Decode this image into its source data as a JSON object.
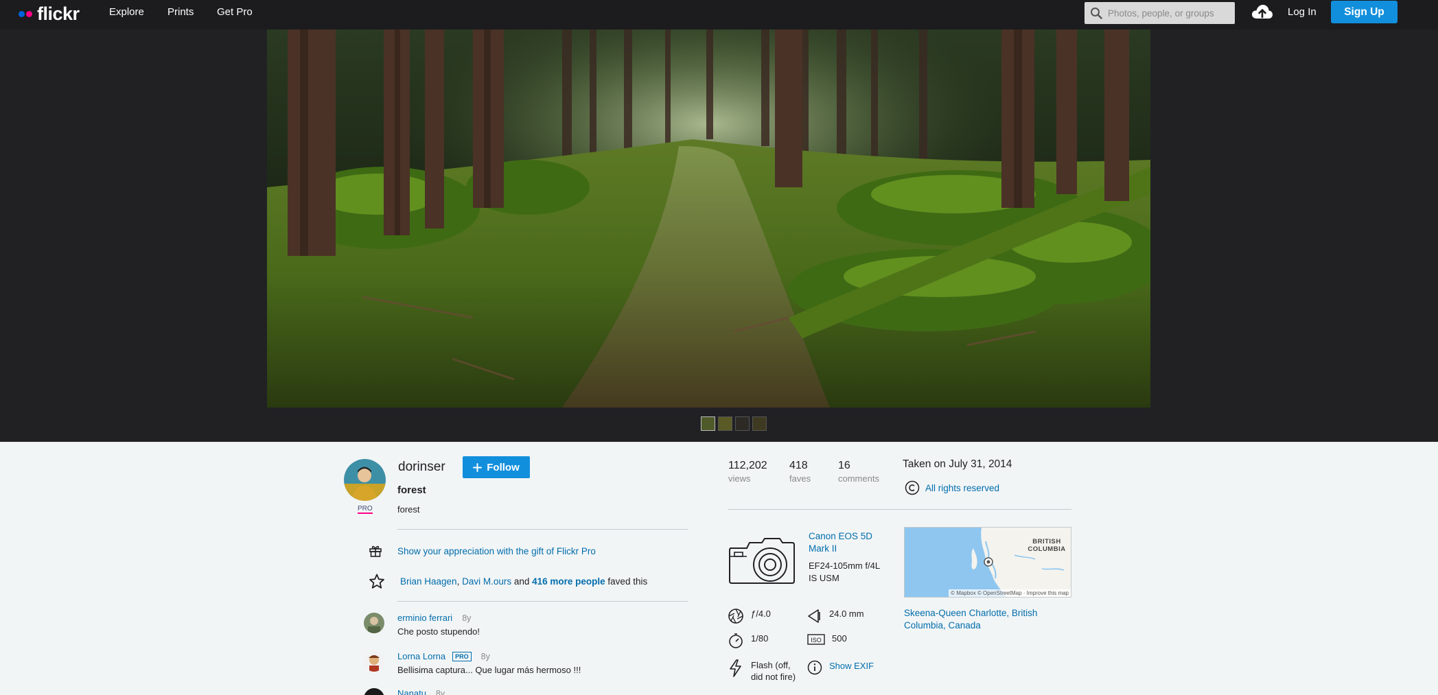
{
  "nav": {
    "logo": "flickr",
    "links": [
      "Explore",
      "Prints",
      "Get Pro"
    ],
    "search_placeholder": "Photos, people, or groups",
    "login": "Log In",
    "signup": "Sign Up"
  },
  "photo": {
    "alt": "forest",
    "thumbs_count": 4
  },
  "owner": {
    "name": "dorinser",
    "badge": "PRO",
    "follow_label": "Follow"
  },
  "title": "forest",
  "description": "forest",
  "gift": {
    "text": "Show your appreciation with the gift of Flickr Pro"
  },
  "faves_line": {
    "user1": "Brian Haagen",
    "sep": ", ",
    "user2": "Davi M.ours",
    "and": " and ",
    "more": "416 more people",
    "suffix": " faved this"
  },
  "comments": [
    {
      "author": "erminio ferrari",
      "badge": "",
      "age": "8y",
      "text": "Che posto stupendo!"
    },
    {
      "author": "Lorna Lorna",
      "badge": "PRO",
      "age": "8y",
      "text": "Bellisima captura... Que lugar más hermoso !!!"
    },
    {
      "author": "Nanatu",
      "badge": "",
      "age": "8y",
      "text": ""
    }
  ],
  "stats": {
    "views": "112,202",
    "views_label": "views",
    "faves": "418",
    "faves_label": "faves",
    "comments": "16",
    "comments_label": "comments"
  },
  "taken": "Taken on July 31, 2014",
  "rights": "All rights reserved",
  "camera": {
    "name": "Canon EOS 5D Mark II",
    "lens": "EF24-105mm f/4L IS USM"
  },
  "exif": {
    "aperture": "ƒ/4.0",
    "focal": "24.0 mm",
    "shutter": "1/80",
    "iso": "500",
    "flash": "Flash (off, did not fire)",
    "show_exif": "Show EXIF"
  },
  "map": {
    "label": "BRITISH COLUMBIA",
    "attribution": "© Mapbox © OpenStreetMap · Improve this map"
  },
  "location": "Skeena-Queen Charlotte, British Columbia, Canada",
  "colors": {
    "brand_blue": "#0063dc",
    "brand_pink": "#ff0084",
    "button_blue": "#128fdc",
    "link": "#006dac"
  }
}
